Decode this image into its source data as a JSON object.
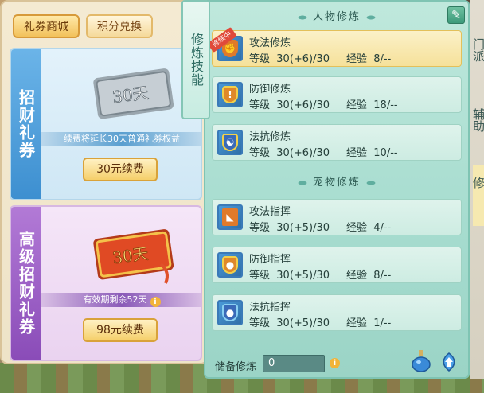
{
  "shop": {
    "tabs": [
      {
        "label": "礼券商城",
        "active": true
      },
      {
        "label": "积分兑换",
        "active": false
      }
    ],
    "tickets": [
      {
        "name": "招财礼券",
        "badge": "30天",
        "description": "续费将延长30天普通礼券权益",
        "button": "30元续费"
      },
      {
        "name": "高级招财礼券",
        "badge": "30天",
        "description": "有效期剩余52天",
        "button": "98元续费"
      }
    ]
  },
  "cultivation": {
    "vertical_label": "修炼技能",
    "character_section": "人物修炼",
    "pet_section": "宠物修炼",
    "active_ribbon": "修炼中",
    "character_skills": [
      {
        "name": "攻法修炼",
        "level_label": "等级",
        "level": "30(+6)/30",
        "exp_label": "经验",
        "exp": "8/--",
        "icon": "fist-icon"
      },
      {
        "name": "防御修炼",
        "level_label": "等级",
        "level": "30(+6)/30",
        "exp_label": "经验",
        "exp": "18/--",
        "icon": "shield-icon"
      },
      {
        "name": "法抗修炼",
        "level_label": "等级",
        "level": "30(+6)/30",
        "exp_label": "经验",
        "exp": "10/--",
        "icon": "yinyang-icon"
      }
    ],
    "pet_skills": [
      {
        "name": "攻法指挥",
        "level_label": "等级",
        "level": "30(+5)/30",
        "exp_label": "经验",
        "exp": "4/--",
        "icon": "pizza-paw-icon"
      },
      {
        "name": "防御指挥",
        "level_label": "等级",
        "level": "30(+5)/30",
        "exp_label": "经验",
        "exp": "8/--",
        "icon": "paw-shield-icon"
      },
      {
        "name": "法抗指挥",
        "level_label": "等级",
        "level": "30(+5)/30",
        "exp_label": "经验",
        "exp": "1/--",
        "icon": "paw-magic-icon"
      }
    ],
    "reserve_label": "储备修炼",
    "reserve_value": "0"
  },
  "edge_tabs": [
    "门派",
    "辅助",
    "修"
  ],
  "colors": {
    "accent": "#f5cf6a",
    "panel": "#bfe8dc",
    "active_row": "#f6e19a"
  }
}
